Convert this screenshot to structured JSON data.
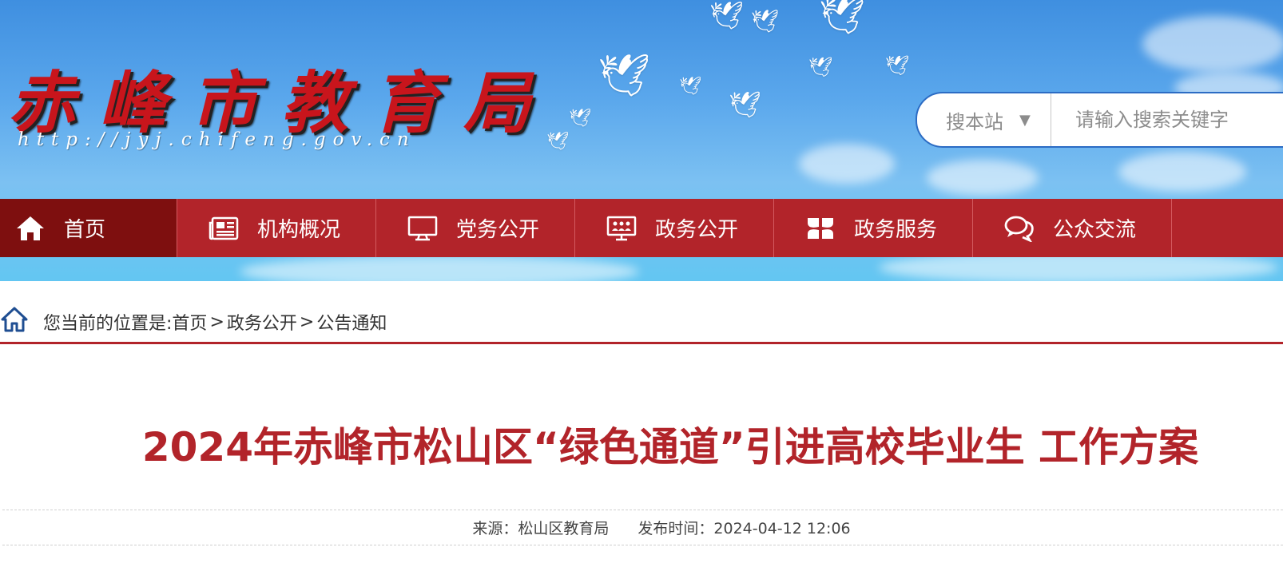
{
  "header": {
    "site_title": "赤峰市教育局",
    "site_url": "http://jyj.chifeng.gov.cn"
  },
  "search": {
    "scope_label": "搜本站",
    "scope_arrow": "▼",
    "placeholder": "请输入搜索关键字"
  },
  "nav": {
    "items": [
      {
        "label": "首页",
        "icon": "home-icon"
      },
      {
        "label": "机构概况",
        "icon": "newspaper-icon"
      },
      {
        "label": "党务公开",
        "icon": "monitor-icon"
      },
      {
        "label": "政务公开",
        "icon": "people-board-icon"
      },
      {
        "label": "政务服务",
        "icon": "four-leaf-icon"
      },
      {
        "label": "公众交流",
        "icon": "chat-bubbles-icon"
      }
    ]
  },
  "breadcrumb": {
    "prefix": "您当前的位置是:",
    "path_1": "首页",
    "sep": ">",
    "path_2": "政务公开",
    "path_3": "公告通知"
  },
  "article": {
    "title": "2024年赤峰市松山区“绿色通道”引进高校毕业生 工作方案",
    "source_label": "来源：松山区教育局",
    "publish_label": "发布时间：2024-04-12 12:06"
  },
  "colors": {
    "nav_bg": "#b2242a",
    "nav_active": "#7e0f0f",
    "title_red": "#b2242a",
    "search_border": "#2c6cc4"
  }
}
